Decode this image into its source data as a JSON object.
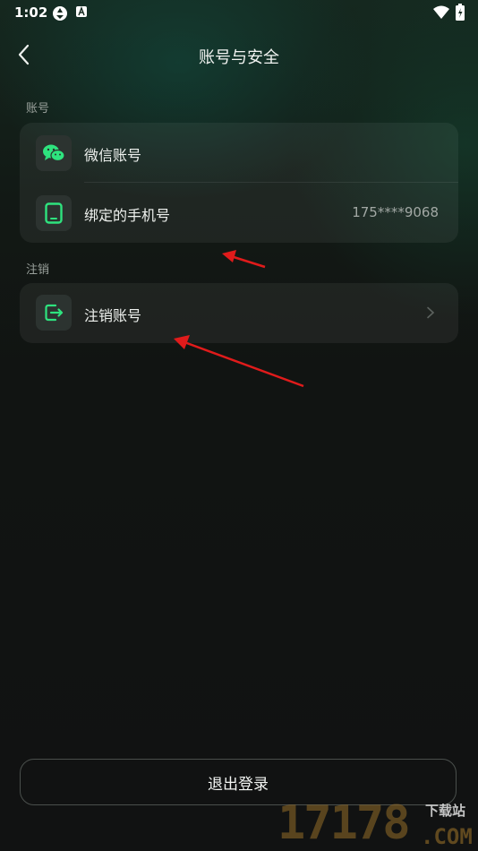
{
  "status_bar": {
    "time": "1:02"
  },
  "header": {
    "title": "账号与安全"
  },
  "sections": {
    "account": {
      "label": "账号",
      "items": [
        {
          "label": "微信账号",
          "value": ""
        },
        {
          "label": "绑定的手机号",
          "value": "175****9068"
        }
      ]
    },
    "cancel": {
      "label": "注销",
      "items": [
        {
          "label": "注销账号"
        }
      ]
    }
  },
  "footer": {
    "logout_label": "退出登录"
  },
  "watermark": {
    "number": "17178",
    "site": "下载站",
    "domain": ".COM"
  },
  "colors": {
    "accent": "#2ee37e",
    "annotation": "#e01b1b"
  }
}
